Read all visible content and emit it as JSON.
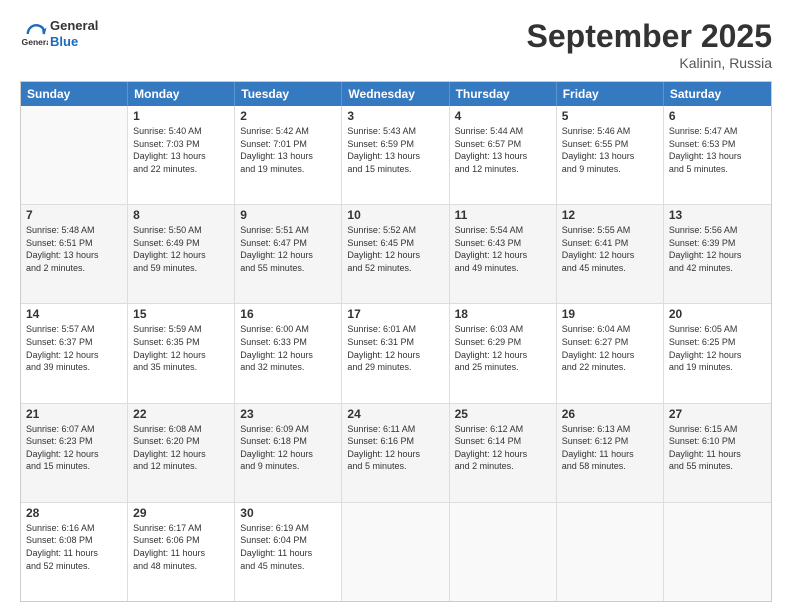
{
  "header": {
    "logo_line1": "General",
    "logo_line2": "Blue",
    "month": "September 2025",
    "location": "Kalinin, Russia"
  },
  "days_of_week": [
    "Sunday",
    "Monday",
    "Tuesday",
    "Wednesday",
    "Thursday",
    "Friday",
    "Saturday"
  ],
  "weeks": [
    [
      {
        "day": "",
        "info": ""
      },
      {
        "day": "1",
        "info": "Sunrise: 5:40 AM\nSunset: 7:03 PM\nDaylight: 13 hours\nand 22 minutes."
      },
      {
        "day": "2",
        "info": "Sunrise: 5:42 AM\nSunset: 7:01 PM\nDaylight: 13 hours\nand 19 minutes."
      },
      {
        "day": "3",
        "info": "Sunrise: 5:43 AM\nSunset: 6:59 PM\nDaylight: 13 hours\nand 15 minutes."
      },
      {
        "day": "4",
        "info": "Sunrise: 5:44 AM\nSunset: 6:57 PM\nDaylight: 13 hours\nand 12 minutes."
      },
      {
        "day": "5",
        "info": "Sunrise: 5:46 AM\nSunset: 6:55 PM\nDaylight: 13 hours\nand 9 minutes."
      },
      {
        "day": "6",
        "info": "Sunrise: 5:47 AM\nSunset: 6:53 PM\nDaylight: 13 hours\nand 5 minutes."
      }
    ],
    [
      {
        "day": "7",
        "info": "Sunrise: 5:48 AM\nSunset: 6:51 PM\nDaylight: 13 hours\nand 2 minutes."
      },
      {
        "day": "8",
        "info": "Sunrise: 5:50 AM\nSunset: 6:49 PM\nDaylight: 12 hours\nand 59 minutes."
      },
      {
        "day": "9",
        "info": "Sunrise: 5:51 AM\nSunset: 6:47 PM\nDaylight: 12 hours\nand 55 minutes."
      },
      {
        "day": "10",
        "info": "Sunrise: 5:52 AM\nSunset: 6:45 PM\nDaylight: 12 hours\nand 52 minutes."
      },
      {
        "day": "11",
        "info": "Sunrise: 5:54 AM\nSunset: 6:43 PM\nDaylight: 12 hours\nand 49 minutes."
      },
      {
        "day": "12",
        "info": "Sunrise: 5:55 AM\nSunset: 6:41 PM\nDaylight: 12 hours\nand 45 minutes."
      },
      {
        "day": "13",
        "info": "Sunrise: 5:56 AM\nSunset: 6:39 PM\nDaylight: 12 hours\nand 42 minutes."
      }
    ],
    [
      {
        "day": "14",
        "info": "Sunrise: 5:57 AM\nSunset: 6:37 PM\nDaylight: 12 hours\nand 39 minutes."
      },
      {
        "day": "15",
        "info": "Sunrise: 5:59 AM\nSunset: 6:35 PM\nDaylight: 12 hours\nand 35 minutes."
      },
      {
        "day": "16",
        "info": "Sunrise: 6:00 AM\nSunset: 6:33 PM\nDaylight: 12 hours\nand 32 minutes."
      },
      {
        "day": "17",
        "info": "Sunrise: 6:01 AM\nSunset: 6:31 PM\nDaylight: 12 hours\nand 29 minutes."
      },
      {
        "day": "18",
        "info": "Sunrise: 6:03 AM\nSunset: 6:29 PM\nDaylight: 12 hours\nand 25 minutes."
      },
      {
        "day": "19",
        "info": "Sunrise: 6:04 AM\nSunset: 6:27 PM\nDaylight: 12 hours\nand 22 minutes."
      },
      {
        "day": "20",
        "info": "Sunrise: 6:05 AM\nSunset: 6:25 PM\nDaylight: 12 hours\nand 19 minutes."
      }
    ],
    [
      {
        "day": "21",
        "info": "Sunrise: 6:07 AM\nSunset: 6:23 PM\nDaylight: 12 hours\nand 15 minutes."
      },
      {
        "day": "22",
        "info": "Sunrise: 6:08 AM\nSunset: 6:20 PM\nDaylight: 12 hours\nand 12 minutes."
      },
      {
        "day": "23",
        "info": "Sunrise: 6:09 AM\nSunset: 6:18 PM\nDaylight: 12 hours\nand 9 minutes."
      },
      {
        "day": "24",
        "info": "Sunrise: 6:11 AM\nSunset: 6:16 PM\nDaylight: 12 hours\nand 5 minutes."
      },
      {
        "day": "25",
        "info": "Sunrise: 6:12 AM\nSunset: 6:14 PM\nDaylight: 12 hours\nand 2 minutes."
      },
      {
        "day": "26",
        "info": "Sunrise: 6:13 AM\nSunset: 6:12 PM\nDaylight: 11 hours\nand 58 minutes."
      },
      {
        "day": "27",
        "info": "Sunrise: 6:15 AM\nSunset: 6:10 PM\nDaylight: 11 hours\nand 55 minutes."
      }
    ],
    [
      {
        "day": "28",
        "info": "Sunrise: 6:16 AM\nSunset: 6:08 PM\nDaylight: 11 hours\nand 52 minutes."
      },
      {
        "day": "29",
        "info": "Sunrise: 6:17 AM\nSunset: 6:06 PM\nDaylight: 11 hours\nand 48 minutes."
      },
      {
        "day": "30",
        "info": "Sunrise: 6:19 AM\nSunset: 6:04 PM\nDaylight: 11 hours\nand 45 minutes."
      },
      {
        "day": "",
        "info": ""
      },
      {
        "day": "",
        "info": ""
      },
      {
        "day": "",
        "info": ""
      },
      {
        "day": "",
        "info": ""
      }
    ]
  ]
}
